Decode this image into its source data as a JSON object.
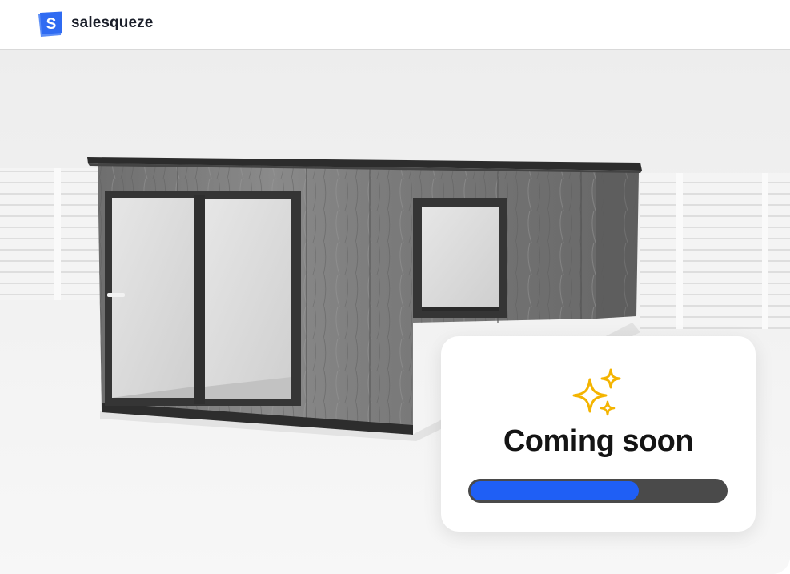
{
  "header": {
    "brand_name": "salesqueze",
    "logo_letter": "S",
    "logo_color": "#2f6bf2"
  },
  "viewport": {
    "scene_icon": "garden-room-3d-model"
  },
  "card": {
    "icon": "sparkles-icon",
    "title": "Coming soon",
    "progress": 0.66,
    "progress_color": "#1f5ff5",
    "track_color": "#4a4a4a",
    "sparkle_color": "#f4b400"
  }
}
